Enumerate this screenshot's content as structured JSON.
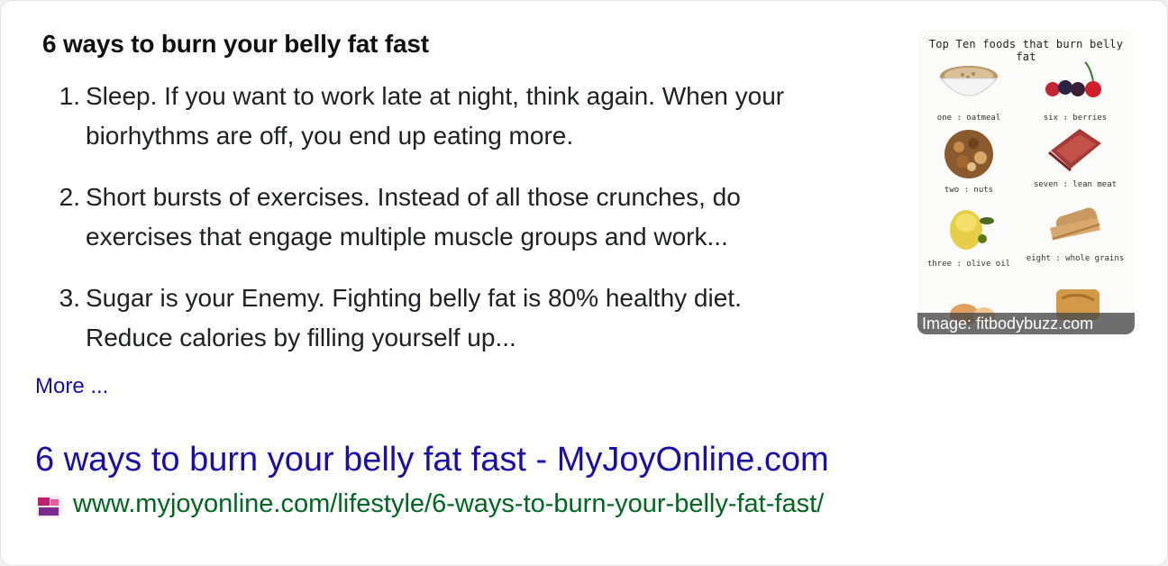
{
  "snippet": {
    "heading": "6 ways to burn your belly fat fast",
    "steps": [
      {
        "number": "1.",
        "lines": [
          "Sleep. If you want to work late at night, think again. When your",
          "biorhythms are off, you end up eating more."
        ]
      },
      {
        "number": "2.",
        "lines": [
          "Short bursts of exercises. Instead of all those crunches, do",
          "exercises that engage multiple muscle groups and work..."
        ]
      },
      {
        "number": "3.",
        "lines": [
          "Sugar is your Enemy. Fighting belly fat is 80% healthy diet.",
          "Reduce calories by filling yourself up..."
        ]
      }
    ],
    "more_label": "More ..."
  },
  "thumbnail": {
    "title": "Top Ten foods that burn belly fat",
    "foods": [
      {
        "caption": "one : oatmeal",
        "icon": "oatmeal-bowl-icon"
      },
      {
        "caption": "six : berries",
        "icon": "berries-icon"
      },
      {
        "caption": "two : nuts",
        "icon": "nuts-icon"
      },
      {
        "caption": "seven : lean meat",
        "icon": "lean-meat-icon"
      },
      {
        "caption": "three : olive oil",
        "icon": "olive-oil-icon"
      },
      {
        "caption": "eight : whole grains",
        "icon": "whole-grains-icon"
      }
    ],
    "caption": "Image: fitbodybuzz.com"
  },
  "result": {
    "title": "6 ways to burn your belly fat fast - MyJoyOnline.com",
    "url": "www.myjoyonline.com/lifestyle/6-ways-to-burn-your-belly-fat-fast/",
    "favicon": "myjoyonline-favicon-icon"
  },
  "colors": {
    "link": "#1a0dab",
    "url": "#006621",
    "text": "#202124"
  }
}
